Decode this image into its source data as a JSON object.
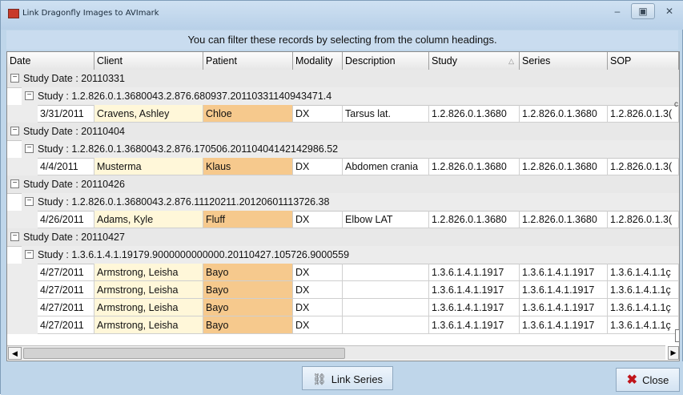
{
  "window": {
    "title": "Link Dragonfly Images to AVImark",
    "minimize_glyph": "–",
    "maximize_glyph": "▣",
    "close_glyph": "✕"
  },
  "banner": "You can filter these records by selecting from the column headings.",
  "columns": [
    "Date",
    "Client",
    "Patient",
    "Modality",
    "Description",
    "Study",
    "Series",
    "SOP"
  ],
  "sort_indicator": "△",
  "groups": [
    {
      "study_date": "Study Date : 20110331",
      "study": "Study : 1.2.826.0.1.3680043.2.876.680937.20110331140943471.4",
      "rows": [
        {
          "date": "3/31/2011",
          "client": "Cravens, Ashley",
          "patient": "Chloe",
          "modality": "DX",
          "description": "Tarsus lat.",
          "study": "1.2.826.0.1.3680",
          "series": "1.2.826.0.1.3680",
          "sop": "1.2.826.0.1.3("
        }
      ]
    },
    {
      "study_date": "Study Date : 20110404",
      "study": "Study : 1.2.826.0.1.3680043.2.876.170506.20110404142142986.52",
      "rows": [
        {
          "date": "4/4/2011",
          "client": "Musterma",
          "patient": "Klaus",
          "modality": "DX",
          "description": "Abdomen crania",
          "study": "1.2.826.0.1.3680",
          "series": "1.2.826.0.1.3680",
          "sop": "1.2.826.0.1.3("
        }
      ]
    },
    {
      "study_date": "Study Date : 20110426",
      "study": "Study : 1.2.826.0.1.3680043.2.876.11120211.20120601113726.38",
      "rows": [
        {
          "date": "4/26/2011",
          "client": "Adams, Kyle",
          "patient": "Fluff",
          "modality": "DX",
          "description": "Elbow LAT",
          "study": "1.2.826.0.1.3680",
          "series": "1.2.826.0.1.3680",
          "sop": "1.2.826.0.1.3("
        }
      ]
    },
    {
      "study_date": "Study Date : 20110427",
      "study": "Study : 1.3.6.1.4.1.19179.9000000000000.20110427.105726.9000559",
      "rows": [
        {
          "date": "4/27/2011",
          "client": "Armstrong, Leisha",
          "patient": "Bayo",
          "modality": "DX",
          "description": "",
          "study": "1.3.6.1.4.1.1917",
          "series": "1.3.6.1.4.1.1917",
          "sop": "1.3.6.1.4.1.1ç"
        },
        {
          "date": "4/27/2011",
          "client": "Armstrong, Leisha",
          "patient": "Bayo",
          "modality": "DX",
          "description": "",
          "study": "1.3.6.1.4.1.1917",
          "series": "1.3.6.1.4.1.1917",
          "sop": "1.3.6.1.4.1.1ç"
        },
        {
          "date": "4/27/2011",
          "client": "Armstrong, Leisha",
          "patient": "Bayo",
          "modality": "DX",
          "description": "",
          "study": "1.3.6.1.4.1.1917",
          "series": "1.3.6.1.4.1.1917",
          "sop": "1.3.6.1.4.1.1ç"
        },
        {
          "date": "4/27/2011",
          "client": "Armstrong, Leisha",
          "patient": "Bayo",
          "modality": "DX",
          "description": "",
          "study": "1.3.6.1.4.1.1917",
          "series": "1.3.6.1.4.1.1917",
          "sop": "1.3.6.1.4.1.1ç"
        }
      ]
    }
  ],
  "toggle_glyph": "−",
  "edge_glyph": "c",
  "buttons": {
    "link_series": "Link Series",
    "close": "Close"
  },
  "icons": {
    "link": "link-icon",
    "close": "close-x-icon"
  },
  "colors": {
    "client_cell": "#fff7d9",
    "patient_cell": "#f6c98d",
    "close_icon": "#c0151b"
  }
}
